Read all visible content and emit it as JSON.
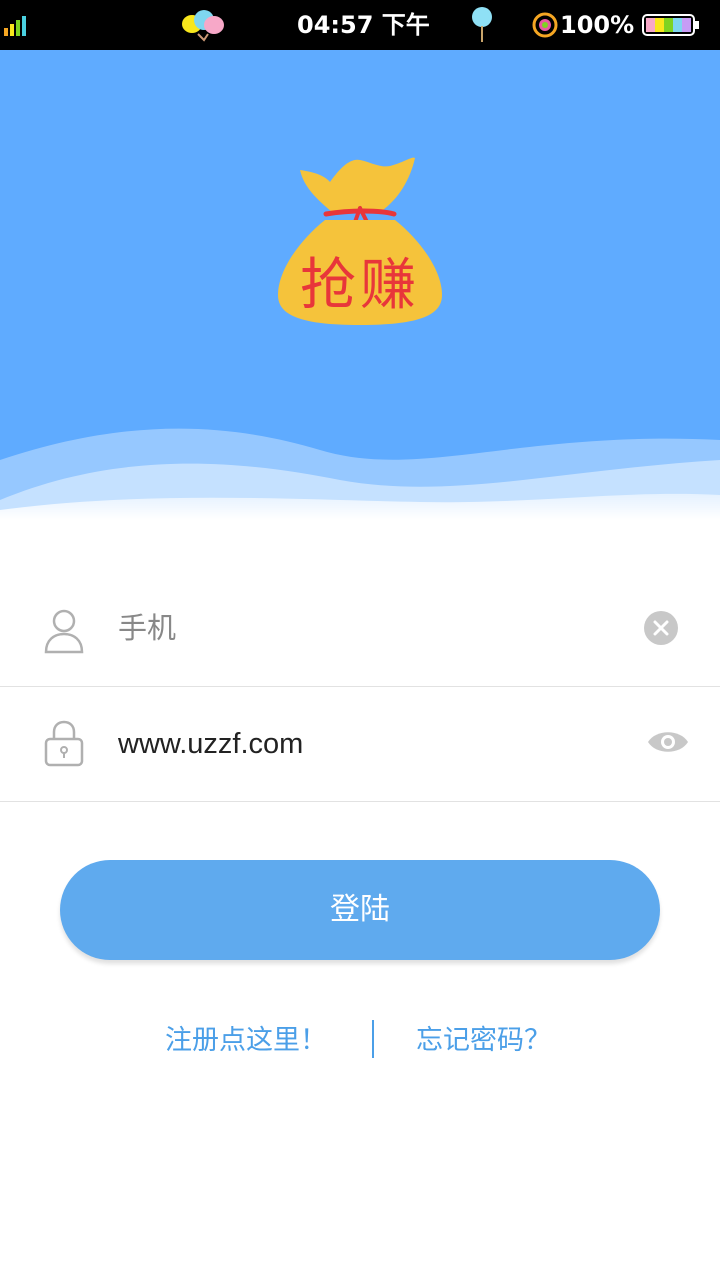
{
  "status_bar": {
    "time": "04:57 下午",
    "battery_percent": "100%",
    "icons": [
      "signal-icon",
      "balloons-icon",
      "lollipop-icon",
      "target-icon",
      "battery-icon"
    ]
  },
  "header": {
    "background_color": "#5fabff",
    "logo_text": "抢赚"
  },
  "form": {
    "phone": {
      "value": "",
      "placeholder": "手机",
      "icon": "user-icon",
      "action_icon": "clear-icon"
    },
    "password": {
      "value": "www.uzzf.com",
      "placeholder": "",
      "icon": "lock-icon",
      "action_icon": "eye-icon"
    }
  },
  "login_button": {
    "label": "登陆",
    "color": "#5faaee"
  },
  "links": {
    "register": "注册点这里！",
    "forgot_password": "忘记密码？",
    "color": "#4b9fe8"
  }
}
